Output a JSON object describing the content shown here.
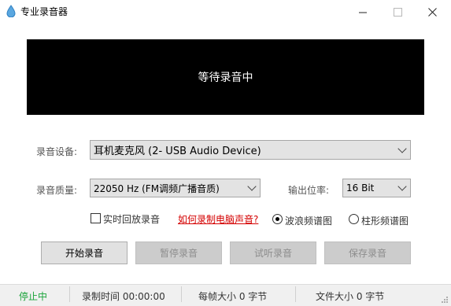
{
  "window": {
    "title": "专业录音器",
    "icon": "water-drop-icon",
    "controls": [
      "minimize-icon",
      "maximize-icon",
      "close-icon"
    ]
  },
  "display": {
    "status_text": "等待录音中"
  },
  "settings": {
    "device_label": "录音设备:",
    "device_value": "耳机麦克风 (2- USB Audio Device)",
    "quality_label": "录音质量:",
    "quality_value": "22050 Hz (FM调频广播音质)",
    "bitrate_label": "输出位率:",
    "bitrate_value": "16 Bit"
  },
  "options": {
    "realtime_playback_label": "实时回放录音",
    "realtime_playback_checked": false,
    "howto_link": "如何录制电脑声音?",
    "wave_spectrum_label": "波浪频谱图",
    "bar_spectrum_label": "柱形频谱图",
    "selected_spectrum": "wave"
  },
  "buttons": {
    "start": "开始录音",
    "pause": "暂停录音",
    "listen": "试听录音",
    "save": "保存录音"
  },
  "statusbar": {
    "state": "停止中",
    "record_time": "录制时间 00:00:00",
    "frame_size": "每帧大小 0 字节",
    "file_size": "文件大小 0 字节"
  },
  "colors": {
    "display_bg": "#000000",
    "status_green": "#1aa33a",
    "link_red": "#d40000"
  }
}
